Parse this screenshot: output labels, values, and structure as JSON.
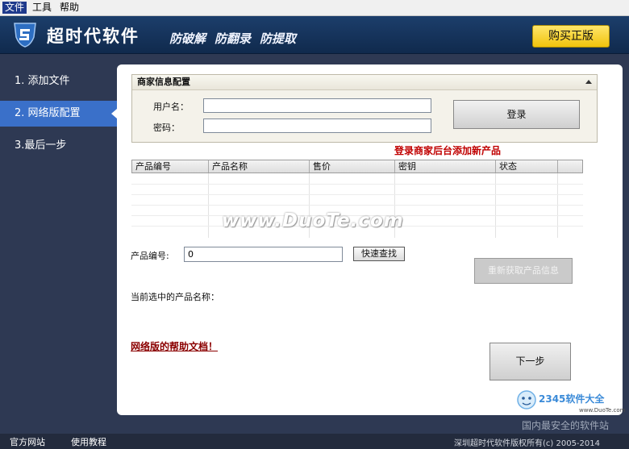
{
  "menu": [
    "文件",
    "工具",
    "帮助"
  ],
  "header": {
    "brand": "超时代软件",
    "slogans": [
      "防破解",
      "防翻录",
      "防提取"
    ],
    "buy_button": "购买正版"
  },
  "sidebar": {
    "items": [
      {
        "label": "1. 添加文件"
      },
      {
        "label": "2. 网络版配置"
      },
      {
        "label": "3.最后一步"
      }
    ]
  },
  "merchant": {
    "title": "商家信息配置",
    "username_label": "用户名：",
    "username_value": "",
    "password_label": "密码：",
    "password_value": "",
    "login_button": "登录",
    "backend_link": "登录商家后台添加新产品"
  },
  "product_table": {
    "columns": [
      "产品编号",
      "产品名称",
      "售价",
      "密钥",
      "状态"
    ],
    "rows": []
  },
  "watermark": "www.DuoTe.com",
  "search": {
    "label": "产品编号:",
    "value": "0",
    "search_button": "快速查找",
    "refresh_button": "重新获取产品信息",
    "selected_label": "当前选中的产品名称："
  },
  "help_link": "网络版的帮助文档！",
  "next_button": "下一步",
  "corner": {
    "logo_text": "2345软件大全",
    "url": "www.DuoTe.com",
    "slogan": "国内最安全的软件站"
  },
  "statusbar": {
    "links": [
      "官方网站",
      "使用教程"
    ],
    "copyright": "深圳超时代软件版权所有(c) 2005-2014"
  },
  "colors": {
    "background": "#2e3953",
    "sidebar_active": "#3a70c9",
    "buy_button": "#f1c30c",
    "link_red": "#c00000"
  }
}
